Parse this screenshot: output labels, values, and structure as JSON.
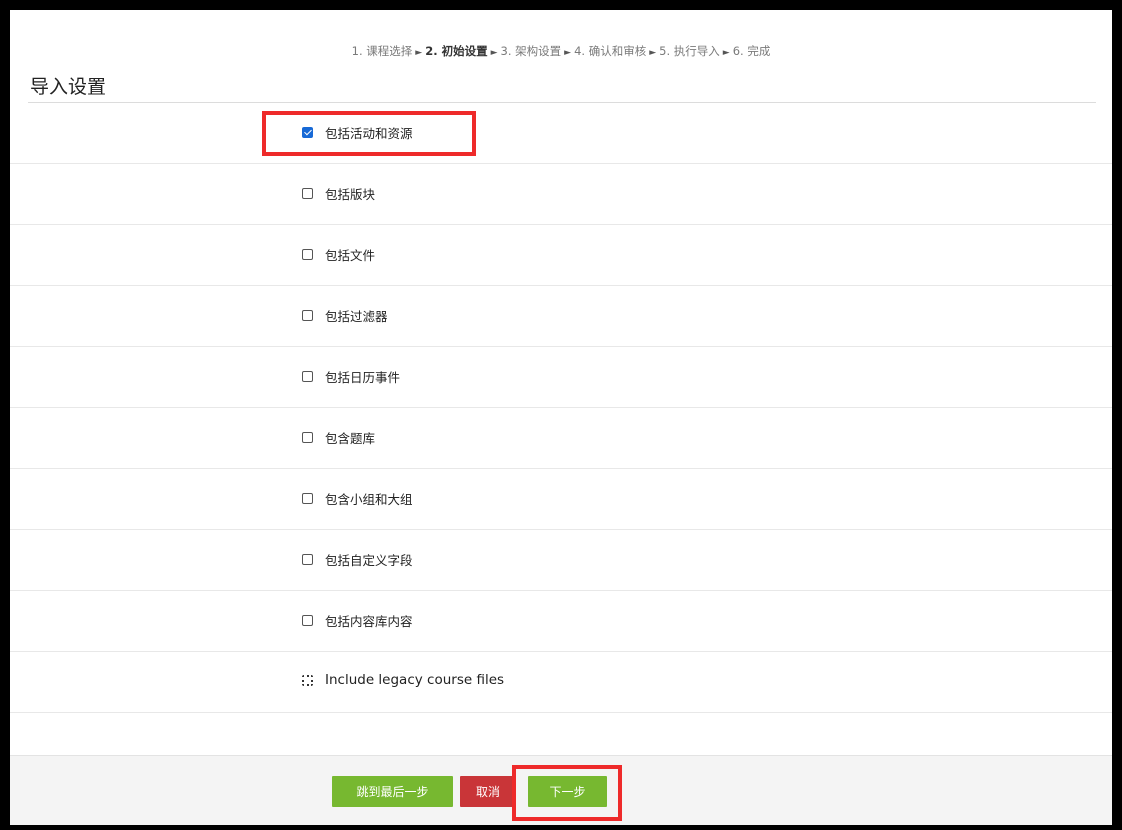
{
  "breadcrumb": {
    "steps": [
      "1. 课程选择",
      "2. 初始设置",
      "3. 架构设置",
      "4. 确认和审核",
      "5. 执行导入",
      "6. 完成"
    ],
    "separator": "►",
    "current_index": 1
  },
  "page_title": "导入设置",
  "settings": [
    {
      "label": "包括活动和资源",
      "checked": true
    },
    {
      "label": "包括版块",
      "checked": false
    },
    {
      "label": "包括文件",
      "checked": false
    },
    {
      "label": "包括过滤器",
      "checked": false
    },
    {
      "label": "包括日历事件",
      "checked": false
    },
    {
      "label": "包含题库",
      "checked": false
    },
    {
      "label": "包含小组和大组",
      "checked": false
    },
    {
      "label": "包括自定义字段",
      "checked": false
    },
    {
      "label": "包括内容库内容",
      "checked": false
    },
    {
      "label": "Include legacy course files",
      "checked": false
    }
  ],
  "buttons": {
    "skip_to_last": "跳到最后一步",
    "cancel": "取消",
    "next": "下一步"
  },
  "colors": {
    "primary_button": "#77b830",
    "cancel_button": "#c93538",
    "highlight": "#ee2a2a",
    "checkbox_checked": "#1769d6"
  }
}
